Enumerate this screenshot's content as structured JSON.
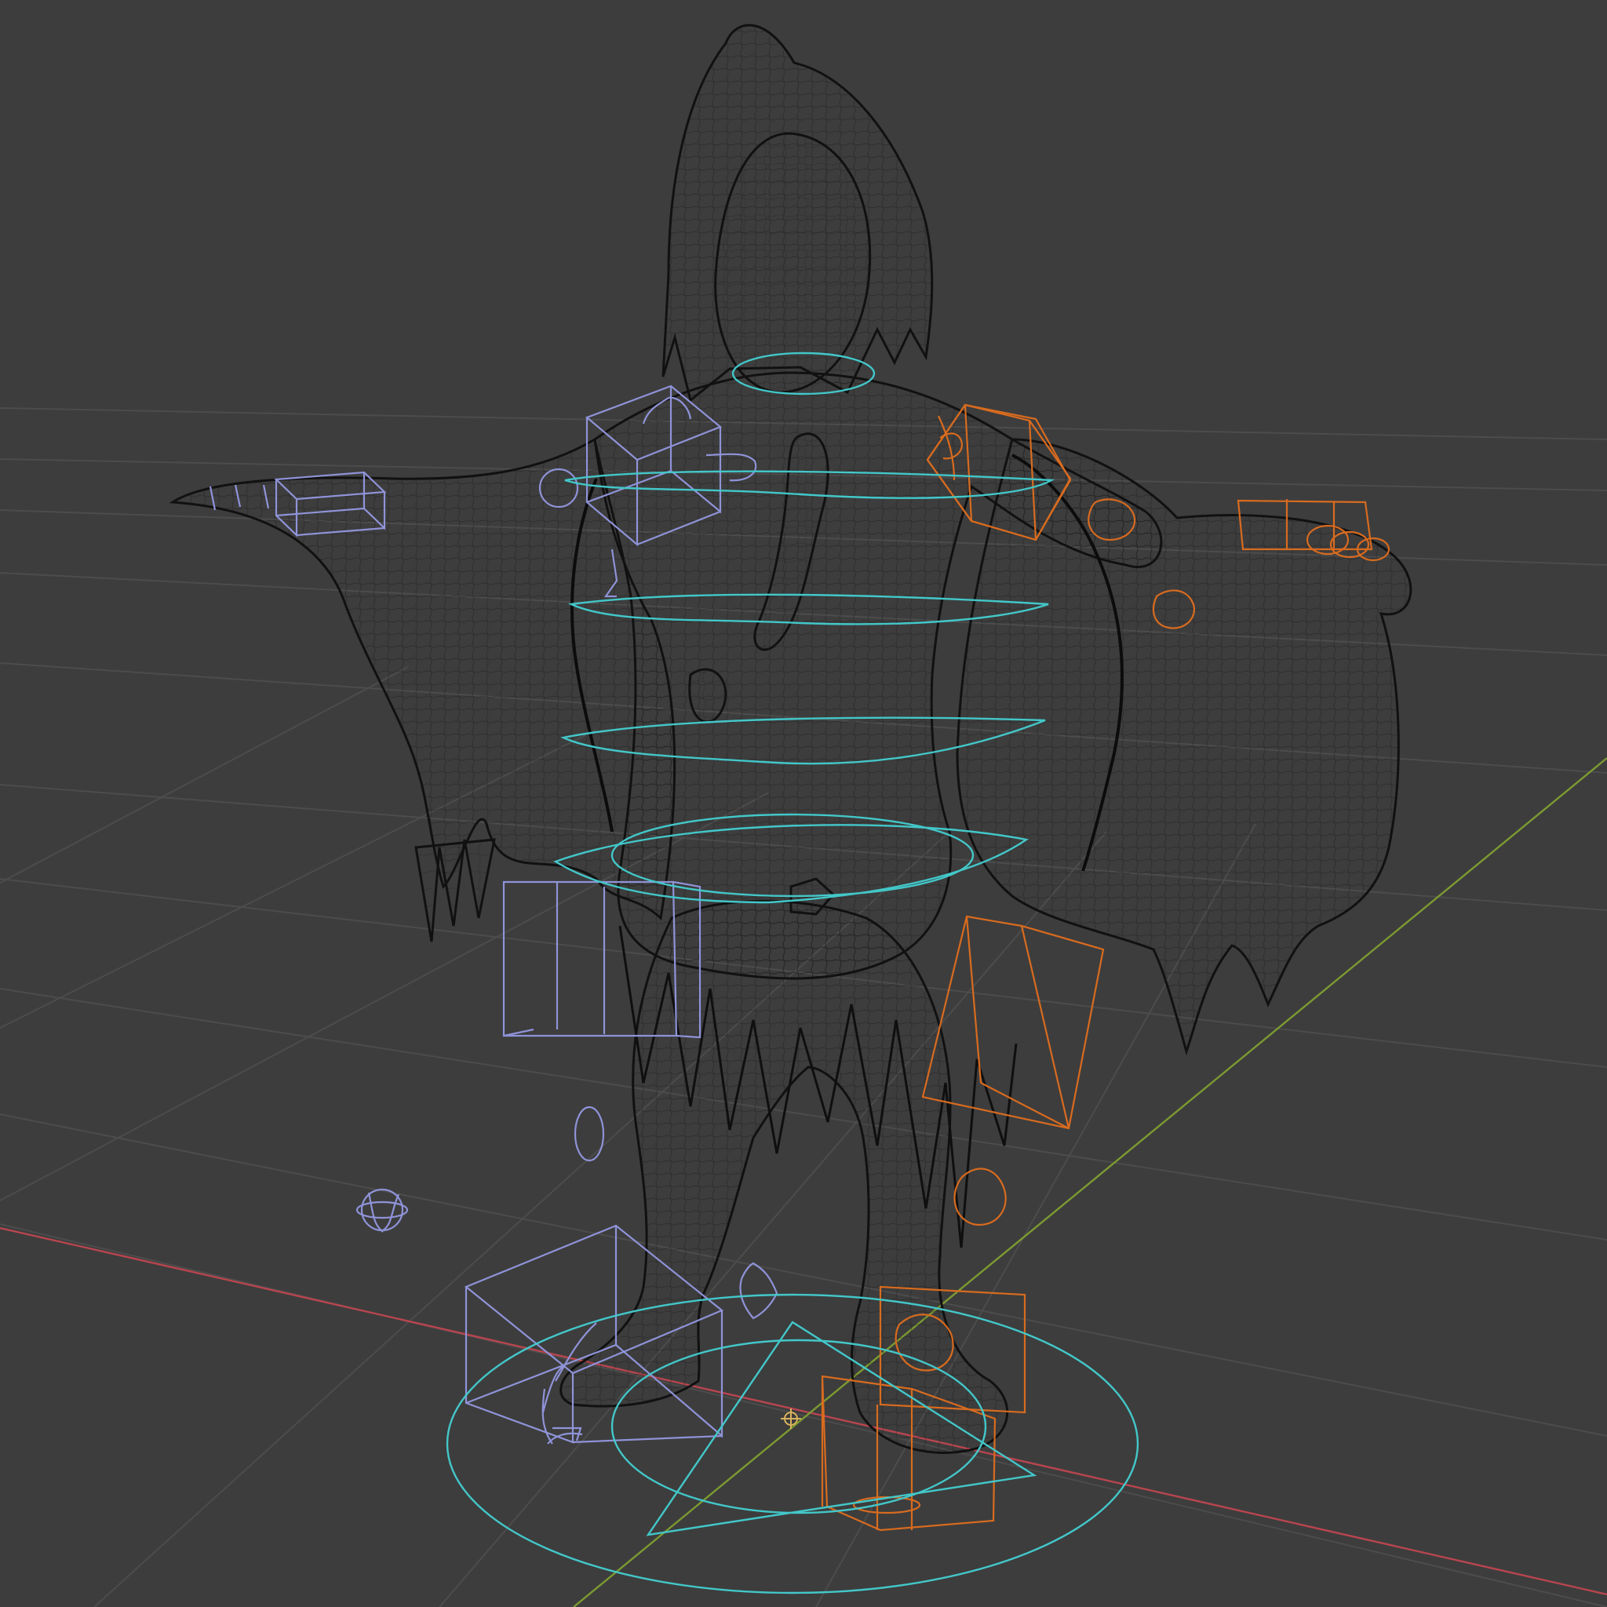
{
  "viewport": {
    "background": "#3d3d3d",
    "grid_color": "#4a4a4a",
    "x_axis_color": "#b8454f",
    "y_axis_color": "#7c9a31",
    "mesh_color": "#111111",
    "left_controls_color": "#8f93d8",
    "right_controls_color": "#d86b1f",
    "center_controls_color": "#43c7c9",
    "origin_icon": "origin-marker-icon"
  }
}
